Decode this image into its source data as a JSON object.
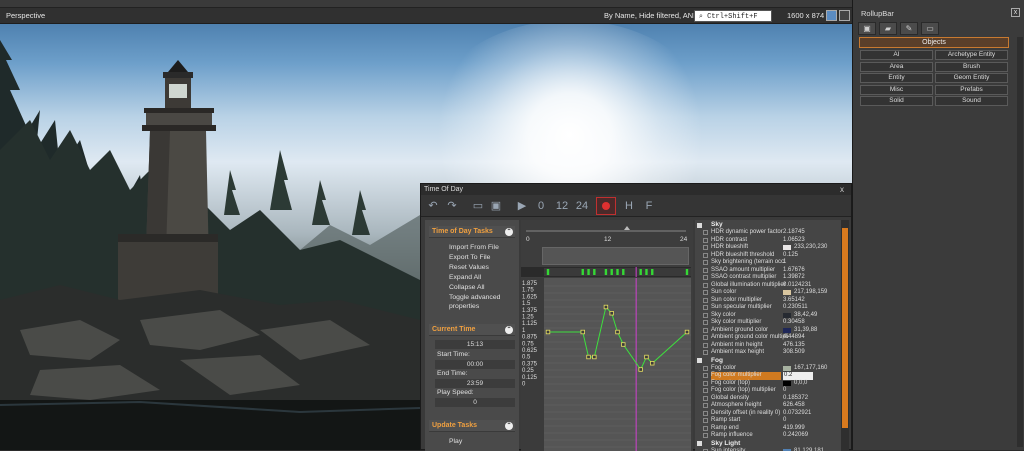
{
  "viewport": {
    "title": "Perspective",
    "filter_text": "By Name, Hide filtered, AND",
    "search_value": "Ctrl+Shift+F",
    "resolution": "1600 x 874"
  },
  "rollup": {
    "title": "RollupBar",
    "close": "x",
    "tabs": [
      "objects-tab",
      "terrain-tab",
      "modify-tab",
      "display-tab"
    ],
    "objects_label": "Objects",
    "buttons": [
      "AI",
      "Archetype Entity",
      "Area",
      "Brush",
      "Entity",
      "Geom Entity",
      "Misc",
      "Prefabs",
      "Solid",
      "Sound"
    ]
  },
  "tod": {
    "title": "Time Of Day",
    "close": "x",
    "toolbar": {
      "t0": "0",
      "t12": "12",
      "t24": "24",
      "h": "H",
      "f": "F"
    },
    "tasks": {
      "tasks_header": "Time of Day Tasks",
      "import": "Import From File",
      "export": "Export To File",
      "reset": "Reset Values",
      "expand": "Expand All",
      "collapse": "Collapse All",
      "toggle": "Toggle advanced",
      "toggle2": "properties",
      "current_header": "Current Time",
      "current_value": "15:13",
      "start_label": "Start Time:",
      "start_value": "00:00",
      "end_label": "End Time:",
      "end_value": "23:59",
      "speed_label": "Play Speed:",
      "speed_value": "0",
      "update_header": "Update Tasks",
      "play": "Play"
    },
    "timeline": {
      "ruler_labels": [
        "0",
        "12",
        "24"
      ],
      "y_labels": [
        "1.875",
        "1.75",
        "1.625",
        "1.5",
        "1.375",
        "1.25",
        "1.125",
        "1",
        "0.875",
        "0.75",
        "0.625",
        "0.5",
        "0.375",
        "0.25",
        "0.125",
        "0"
      ]
    },
    "chart_data": {
      "type": "line",
      "x": [
        0,
        6,
        7,
        8,
        10,
        11,
        12,
        13,
        16,
        17,
        18,
        24
      ],
      "y": [
        1.0,
        1.0,
        0.5,
        0.5,
        1.5,
        1.375,
        1.0,
        0.75,
        0.25,
        0.5,
        0.375,
        1.0
      ],
      "xlim": [
        0,
        24
      ],
      "ylim": [
        0,
        2
      ],
      "current_time": 15.22
    },
    "properties": [
      {
        "kind": "group",
        "name": "Sky"
      },
      {
        "name": "HDR dynamic power factor",
        "value": "2.18745"
      },
      {
        "name": "HDR contrast",
        "value": "1.06523"
      },
      {
        "name": "HDR blueshift",
        "value": "233,230,230",
        "color": "#e9e6e6"
      },
      {
        "name": "HDR blueshift threshold",
        "value": "0.125"
      },
      {
        "name": "Sky brightening (terrain occl",
        "value": "1"
      },
      {
        "name": "SSAO amount multiplier",
        "value": "1.67676"
      },
      {
        "name": "SSAO contrast multiplier",
        "value": "1.39872"
      },
      {
        "name": "Global illumination multiplier",
        "value": "0.0124231"
      },
      {
        "name": "Sun color",
        "value": "217,198,159",
        "color": "#d9c69f"
      },
      {
        "name": "Sun color multiplier",
        "value": "3.65142"
      },
      {
        "name": "Sun specular multiplier",
        "value": "0.230511"
      },
      {
        "name": "Sky color",
        "value": "38,42,49",
        "color": "#262a31"
      },
      {
        "name": "Sky color multiplier",
        "value": "0.30458"
      },
      {
        "name": "Ambient ground color",
        "value": "31,39,88",
        "color": "#1f2758"
      },
      {
        "name": "Ambient ground color multipli",
        "value": "4.44894"
      },
      {
        "name": "Ambient min height",
        "value": "476.135"
      },
      {
        "name": "Ambient max height",
        "value": "308.509"
      },
      {
        "kind": "group",
        "name": "Fog"
      },
      {
        "name": "Fog color",
        "value": "167,177,160",
        "color": "#a7b1a0"
      },
      {
        "name": "Fog color multiplier",
        "value": "0.2",
        "selected": true
      },
      {
        "name": "Fog color (top)",
        "value": "0,0,0",
        "color": "#000000"
      },
      {
        "name": "Fog color (top) multiplier",
        "value": "0"
      },
      {
        "name": "Global density",
        "value": "0.185372"
      },
      {
        "name": "Atmosphere height",
        "value": "626.458"
      },
      {
        "name": "Density offset (in reality 0)",
        "value": "0.0732921"
      },
      {
        "name": "Ramp start",
        "value": "0"
      },
      {
        "name": "Ramp end",
        "value": "419.999"
      },
      {
        "name": "Ramp influence",
        "value": "0.242069"
      },
      {
        "kind": "group",
        "name": "Sky Light"
      },
      {
        "name": "Sun intensity",
        "value": "81,129,181",
        "color": "#5181b5"
      }
    ]
  }
}
